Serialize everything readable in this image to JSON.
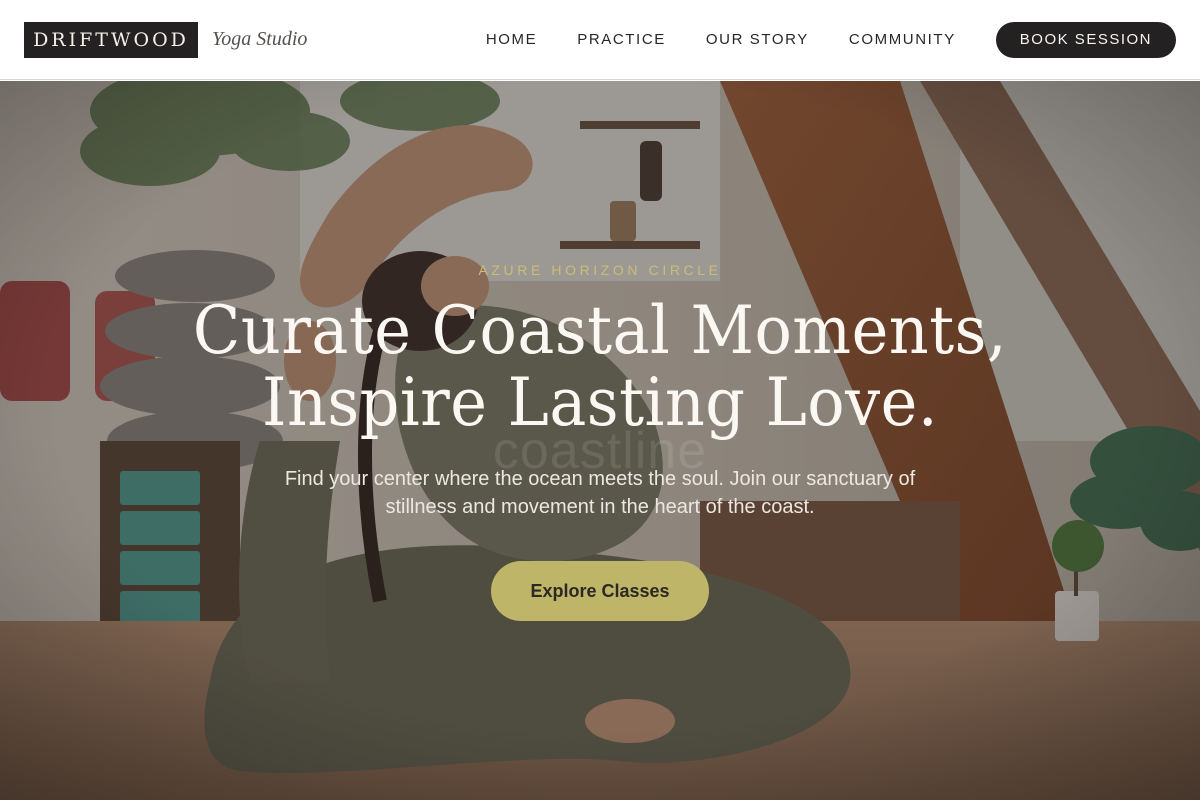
{
  "brand": {
    "logo_text": "DRIFTWOOD",
    "tagline": "Yoga Studio"
  },
  "nav": {
    "items": [
      {
        "label": "HOME"
      },
      {
        "label": "PRACTICE"
      },
      {
        "label": "OUR STORY"
      },
      {
        "label": "COMMUNITY"
      }
    ],
    "cta_label": "BOOK SESSION"
  },
  "hero": {
    "eyebrow": "AZURE HORIZON CIRCLE",
    "headline_line1": "Curate Coastal Moments,",
    "headline_line2": "Inspire Lasting Love.",
    "ghost_word": "coastline",
    "subtext": "Find your center where the ocean meets the soul. Join our sanctuary of stillness and movement in the heart of the coast.",
    "cta_label": "Explore Classes",
    "image_description": "Woman in a seated yoga backbend pose in a wooden studio with plants and bolsters"
  },
  "colors": {
    "header_bg": "#ffffff",
    "dark": "#242123",
    "accent_gold": "#c9be74",
    "cta_bg": "#bfb568"
  }
}
